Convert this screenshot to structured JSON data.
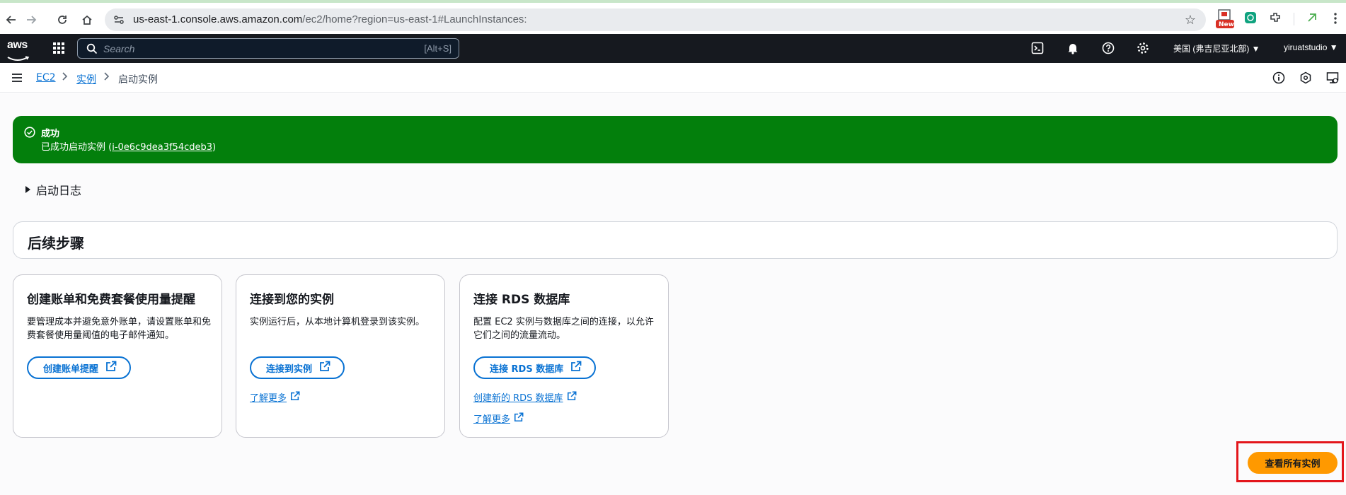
{
  "browser": {
    "url_host": "us-east-1.console.aws.amazon.com",
    "url_path": "/ec2/home?region=us-east-1#LaunchInstances:",
    "new_badge": "New"
  },
  "aws_nav": {
    "logo": "aws",
    "search_placeholder": "Search",
    "search_shortcut": "[Alt+S]",
    "region": "美国 (弗吉尼亚北部) ▼",
    "user": "yiruatstudio ▼"
  },
  "breadcrumb": {
    "items": [
      "EC2",
      "实例",
      "启动实例"
    ]
  },
  "flash": {
    "title": "成功",
    "message_prefix": "已成功启动实例 (",
    "instance_id": "i-0e6c9dea3f54cdeb3",
    "message_suffix": ")"
  },
  "launch_log": {
    "label": "启动日志"
  },
  "next_steps": {
    "title": "后续步骤"
  },
  "cards": [
    {
      "title": "创建账单和免费套餐使用量提醒",
      "description": "要管理成本并避免意外账单，请设置账单和免费套餐使用量阈值的电子邮件通知。",
      "button": "创建账单提醒"
    },
    {
      "title": "连接到您的实例",
      "description": "实例运行后，从本地计算机登录到该实例。",
      "button": "连接到实例",
      "links": [
        "了解更多"
      ]
    },
    {
      "title": "连接 RDS 数据库",
      "description": "配置 EC2 实例与数据库之间的连接，以允许它们之间的流量流动。",
      "button": "连接 RDS 数据库",
      "links": [
        "创建新的 RDS 数据库",
        "了解更多"
      ]
    }
  ],
  "view_all": {
    "label": "查看所有实例"
  },
  "colors": {
    "success": "#037f0c",
    "primary": "#ff9900",
    "link": "#0972d3",
    "nav_bg": "#16191f",
    "highlight": "#e3161b"
  }
}
